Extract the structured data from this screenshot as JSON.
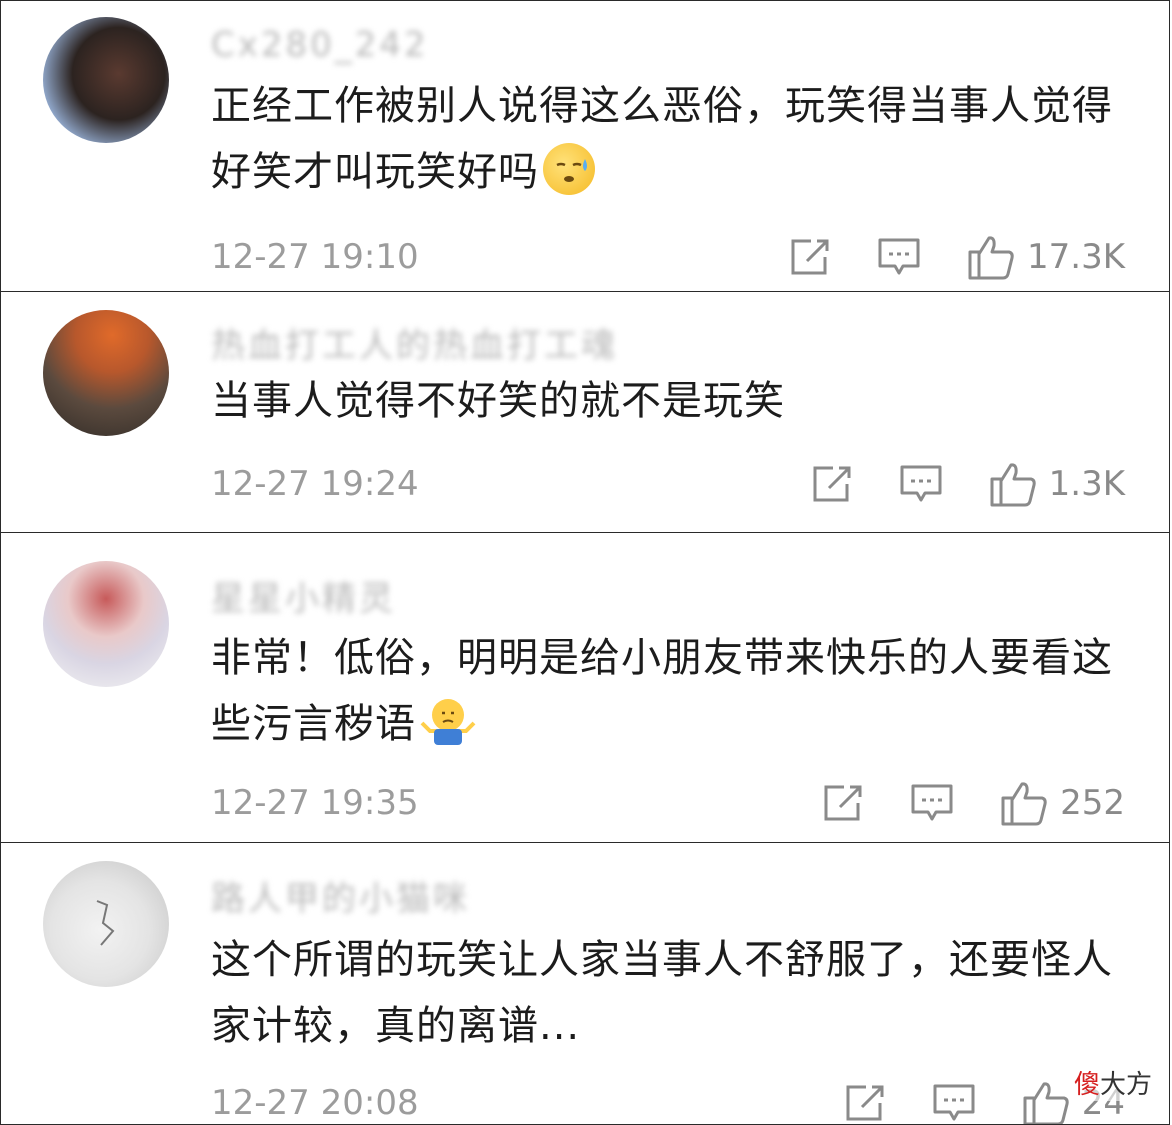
{
  "comments": [
    {
      "username": "Cx280_242",
      "text": "正经工作被别人说得这么恶俗，玩笑得当事人觉得好笑才叫玩笑好吗",
      "emoji": "sweat-face",
      "time": "12-27 19:10",
      "likes": "17.3K"
    },
    {
      "username": "热血打工人的热血打工魂",
      "text": "当事人觉得不好笑的就不是玩笑",
      "time": "12-27 19:24",
      "likes": "1.3K"
    },
    {
      "username": "星星小精灵",
      "text": "非常！低俗，明明是给小朋友带来快乐的人要看这些污言秽语",
      "emoji": "shrug",
      "time": "12-27 19:35",
      "likes": "252"
    },
    {
      "username": "路人甲的小猫咪",
      "text": "这个所谓的玩笑让人家当事人不舒服了，还要怪人家计较，真的离谱...",
      "time": "12-27 20:08",
      "likes": "24"
    }
  ],
  "watermark": {
    "first": "傻",
    "rest": "大方"
  },
  "colors": {
    "border": "#2a2a2a",
    "meta_text": "#9c9c9c",
    "body_text": "#1c1c1c"
  }
}
